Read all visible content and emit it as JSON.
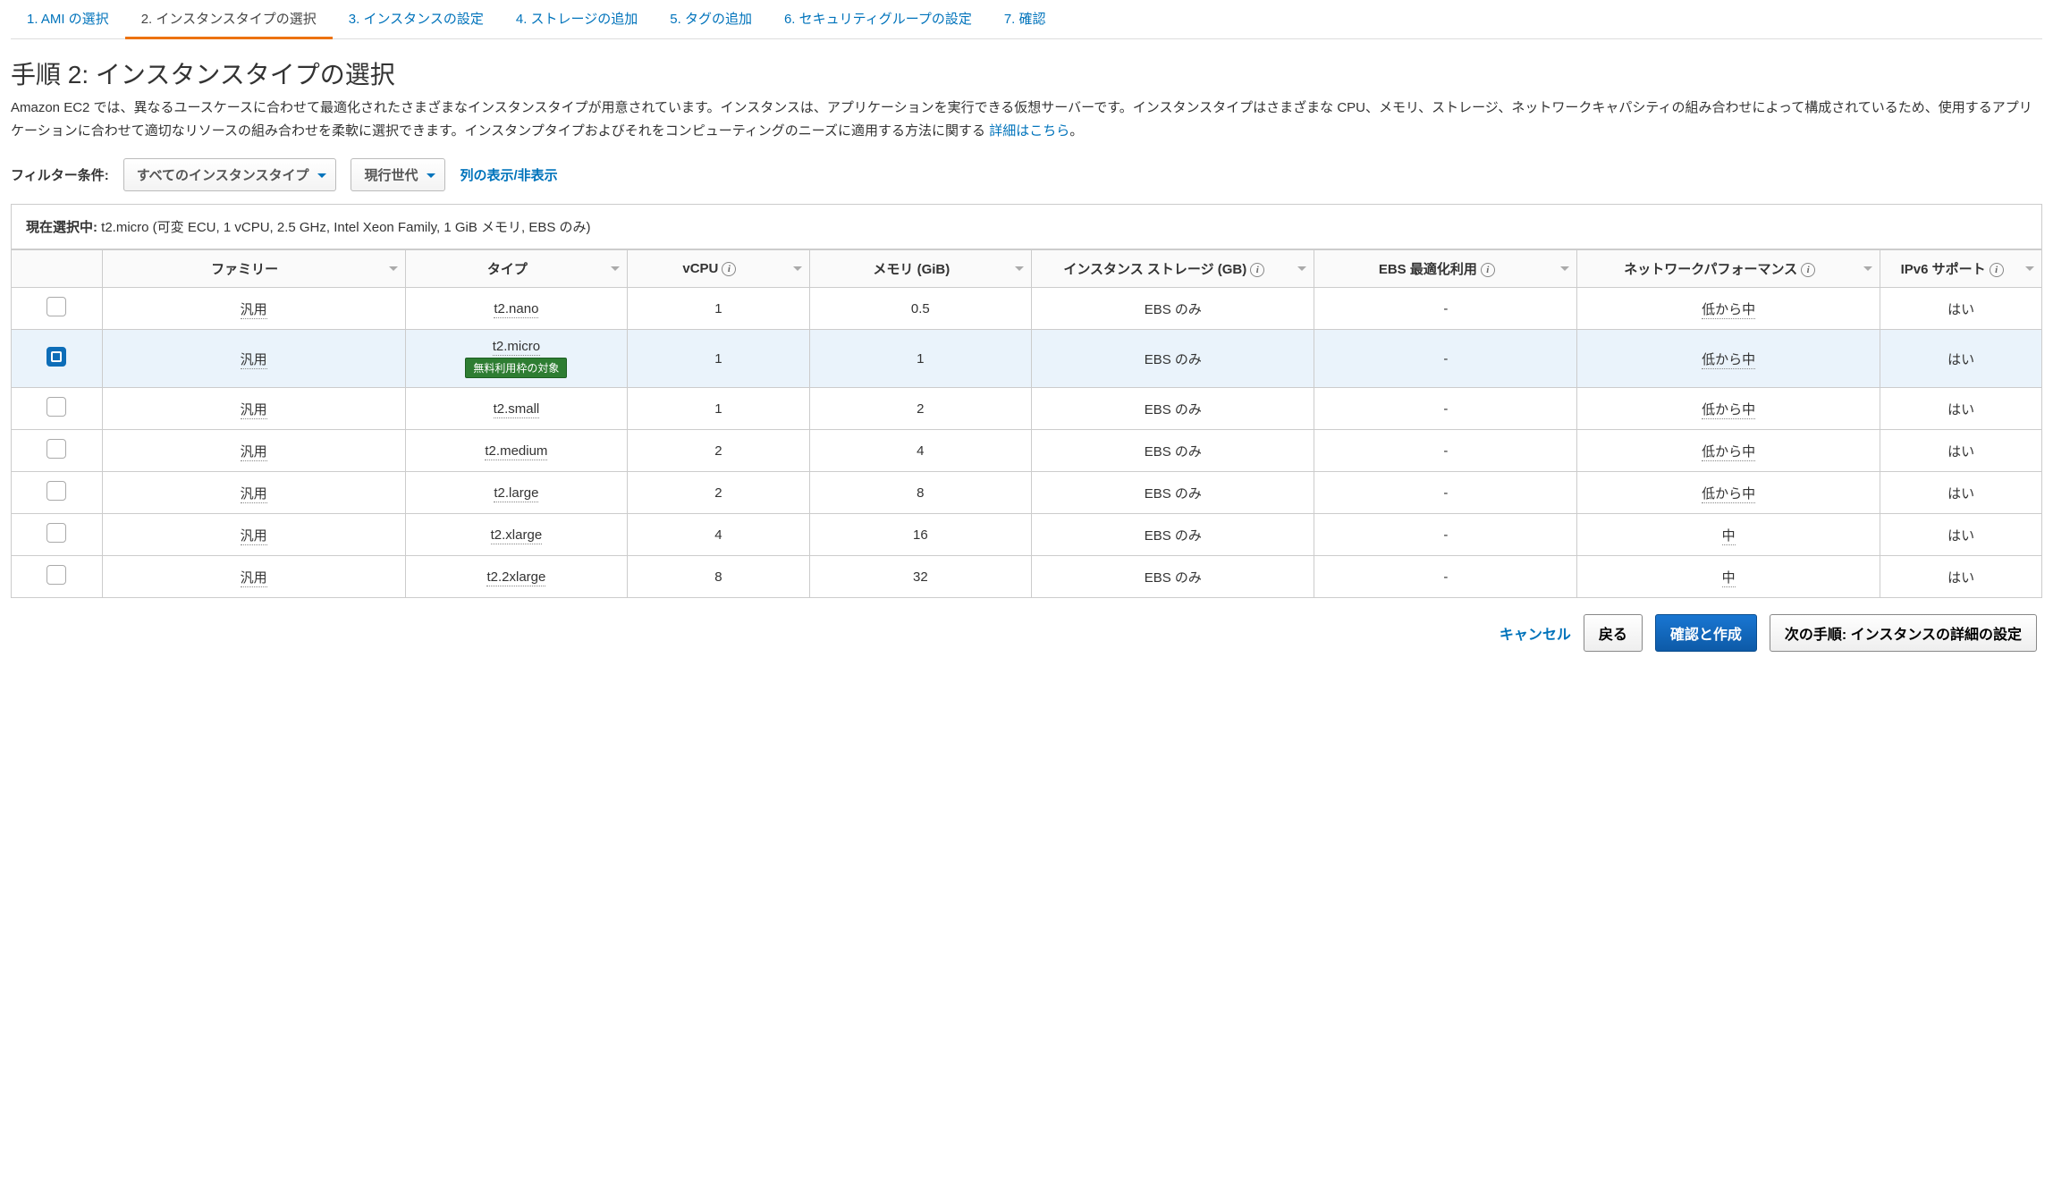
{
  "wizard": {
    "tabs": [
      {
        "label": "1. AMI の選択",
        "active": false
      },
      {
        "label": "2. インスタンスタイプの選択",
        "active": true
      },
      {
        "label": "3. インスタンスの設定",
        "active": false
      },
      {
        "label": "4. ストレージの追加",
        "active": false
      },
      {
        "label": "5. タグの追加",
        "active": false
      },
      {
        "label": "6. セキュリティグループの設定",
        "active": false
      },
      {
        "label": "7. 確認",
        "active": false
      }
    ]
  },
  "page": {
    "title": "手順 2: インスタンスタイプの選択",
    "description_pre": "Amazon EC2 では、異なるユースケースに合わせて最適化されたさまざまなインスタンスタイプが用意されています。インスタンスは、アプリケーションを実行できる仮想サーバーです。インスタンスタイプはさまざまな CPU、メモリ、ストレージ、ネットワークキャパシティの組み合わせによって構成されているため、使用するアプリケーションに合わせて適切なリソースの組み合わせを柔軟に選択できます。インスタンプタイプおよびそれをコンピューティングのニーズに適用する方法に関する ",
    "description_link": "詳細はこちら",
    "description_post": "。"
  },
  "filter": {
    "label": "フィルター条件:",
    "all_types": "すべてのインスタンスタイプ",
    "generation": "現行世代",
    "columns_link": "列の表示/非表示"
  },
  "selection": {
    "label": "現在選択中: ",
    "value": "t2.micro (可変 ECU, 1 vCPU, 2.5 GHz, Intel Xeon Family, 1 GiB メモリ, EBS のみ)"
  },
  "table": {
    "headers": {
      "family": "ファミリー",
      "type": "タイプ",
      "vcpu": "vCPU",
      "memory": "メモリ (GiB)",
      "storage": "インスタンス ストレージ (GB)",
      "ebs": "EBS 最適化利用",
      "network": "ネットワークパフォーマンス",
      "ipv6": "IPv6 サポート"
    },
    "free_tier_badge": "無料利用枠の対象",
    "rows": [
      {
        "selected": false,
        "family": "汎用",
        "type": "t2.nano",
        "vcpu": "1",
        "memory": "0.5",
        "storage": "EBS のみ",
        "ebs": "-",
        "network": "低から中",
        "ipv6": "はい",
        "free": false
      },
      {
        "selected": true,
        "family": "汎用",
        "type": "t2.micro",
        "vcpu": "1",
        "memory": "1",
        "storage": "EBS のみ",
        "ebs": "-",
        "network": "低から中",
        "ipv6": "はい",
        "free": true
      },
      {
        "selected": false,
        "family": "汎用",
        "type": "t2.small",
        "vcpu": "1",
        "memory": "2",
        "storage": "EBS のみ",
        "ebs": "-",
        "network": "低から中",
        "ipv6": "はい",
        "free": false
      },
      {
        "selected": false,
        "family": "汎用",
        "type": "t2.medium",
        "vcpu": "2",
        "memory": "4",
        "storage": "EBS のみ",
        "ebs": "-",
        "network": "低から中",
        "ipv6": "はい",
        "free": false
      },
      {
        "selected": false,
        "family": "汎用",
        "type": "t2.large",
        "vcpu": "2",
        "memory": "8",
        "storage": "EBS のみ",
        "ebs": "-",
        "network": "低から中",
        "ipv6": "はい",
        "free": false
      },
      {
        "selected": false,
        "family": "汎用",
        "type": "t2.xlarge",
        "vcpu": "4",
        "memory": "16",
        "storage": "EBS のみ",
        "ebs": "-",
        "network": "中",
        "ipv6": "はい",
        "free": false
      },
      {
        "selected": false,
        "family": "汎用",
        "type": "t2.2xlarge",
        "vcpu": "8",
        "memory": "32",
        "storage": "EBS のみ",
        "ebs": "-",
        "network": "中",
        "ipv6": "はい",
        "free": false
      }
    ]
  },
  "footer": {
    "cancel": "キャンセル",
    "back": "戻る",
    "review": "確認と作成",
    "next": "次の手順: インスタンスの詳細の設定"
  }
}
